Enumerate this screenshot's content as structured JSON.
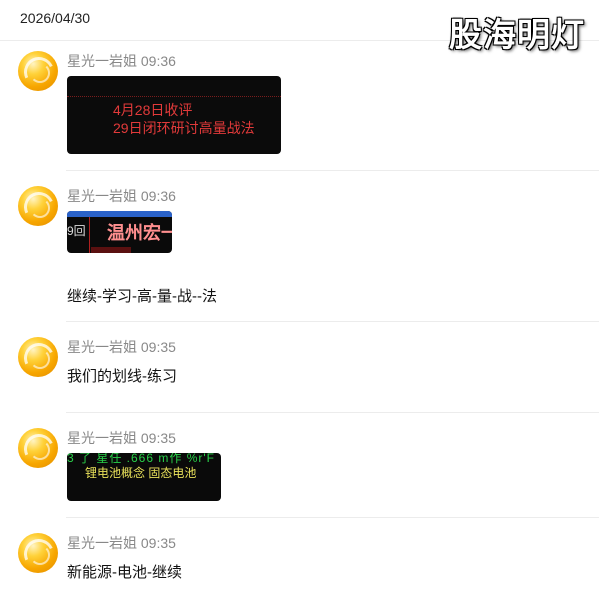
{
  "date": "2026/04/30",
  "watermark": "股海明灯",
  "messages": [
    {
      "sender": "星光一岩姐",
      "time": "09:36",
      "image": {
        "lines": [
          "4月28日收评",
          "29日闭环研讨高量战法"
        ]
      }
    },
    {
      "sender": "星光一岩姐",
      "time": "09:36",
      "image": {
        "left_text": "9回",
        "title": "温州宏一"
      },
      "text": "继续-学习-高-量-战--法"
    },
    {
      "sender": "星光一岩姐",
      "time": "09:35",
      "text": "我们的划线-练习"
    },
    {
      "sender": "星光一岩姐",
      "time": "09:35",
      "image": {
        "top_text": "3 了 星任 .666 m作 %r'F",
        "row_text": "锂电池概念 固态电池 "
      }
    },
    {
      "sender": "星光一岩姐",
      "time": "09:35",
      "text": "新能源-电池-继续"
    }
  ]
}
